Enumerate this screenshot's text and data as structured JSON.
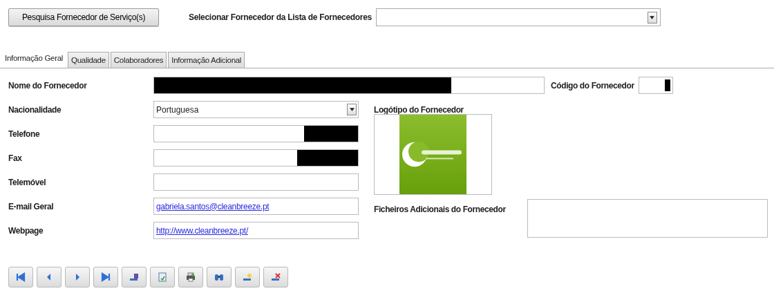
{
  "search_button": {
    "label": "Pesquisa Fornecedor de Serviço(s)"
  },
  "supplier_select": {
    "label": "Selecionar Fornecedor da Lista de Fornecedores"
  },
  "tabs": [
    {
      "label": "Informação Geral",
      "selected": true
    },
    {
      "label": "Qualidade",
      "selected": false
    },
    {
      "label": "Colaboradores",
      "selected": false
    },
    {
      "label": "Informação Adicional",
      "selected": false
    }
  ],
  "name_field": {
    "label": "Nome do Fornecedor",
    "redacted": true
  },
  "code_field": {
    "label": "Código do Fornecedor",
    "redacted": true
  },
  "fields": [
    {
      "label": "Nacionalidade",
      "kind": "select",
      "value": "Portuguesa",
      "redacted": false
    },
    {
      "label": "Telefone",
      "kind": "text",
      "redacted": true
    },
    {
      "label": "Fax",
      "kind": "text",
      "redacted": true
    },
    {
      "label": "Telemóvel",
      "kind": "text",
      "redacted": false
    },
    {
      "label": "E-mail Geral",
      "kind": "link",
      "value": "gabriela.santos@cleanbreeze.pt",
      "redacted": false
    },
    {
      "label": "Webpage",
      "kind": "link",
      "value": "http://www.cleanbreeze.pt/",
      "redacted": false
    }
  ],
  "logo": {
    "label": "Logótipo do Fornecedor",
    "kind": "picture"
  },
  "files": {
    "label": "Ficheiros Adicionais do Fornecedor"
  },
  "toolbar": [
    {
      "kind": "first"
    },
    {
      "kind": "previous"
    },
    {
      "kind": "next"
    },
    {
      "kind": "last"
    },
    {
      "kind": "save"
    },
    {
      "kind": "document"
    },
    {
      "kind": "print"
    },
    {
      "kind": "find"
    },
    {
      "kind": "new"
    },
    {
      "kind": "delete"
    }
  ]
}
